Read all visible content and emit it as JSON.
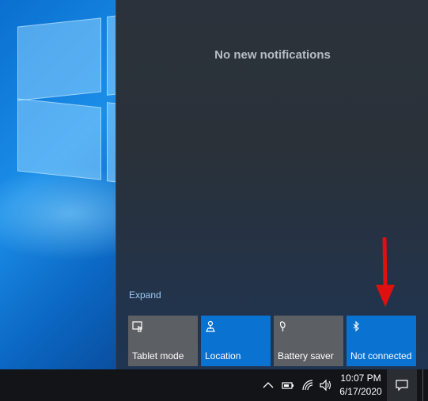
{
  "action_center": {
    "notifications_text": "No new notifications",
    "expand_label": "Expand",
    "tiles": [
      {
        "label": "Tablet mode",
        "icon": "tablet-mode-icon",
        "state": "off"
      },
      {
        "label": "Location",
        "icon": "location-icon",
        "state": "on"
      },
      {
        "label": "Battery saver",
        "icon": "battery-saver-icon",
        "state": "off"
      },
      {
        "label": "Not connected",
        "icon": "bluetooth-icon",
        "state": "on"
      }
    ]
  },
  "taskbar": {
    "time": "10:07 PM",
    "date": "6/17/2020",
    "tray_icons": [
      "chevron-up-icon",
      "battery-icon",
      "wifi-icon",
      "volume-icon"
    ]
  },
  "colors": {
    "tile_on": "#0a72d1",
    "tile_off": "#5c5f63",
    "annotation_arrow": "#e01010"
  }
}
